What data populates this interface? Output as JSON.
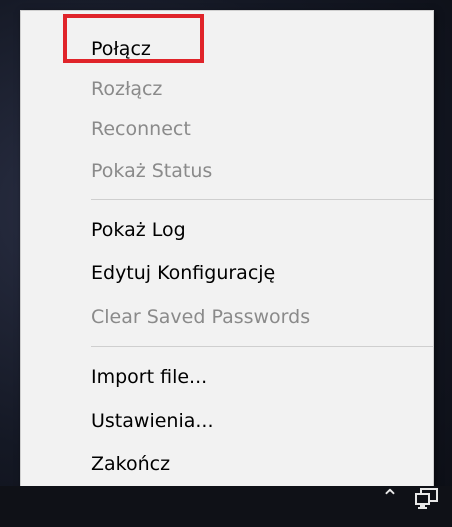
{
  "menu": {
    "items": [
      {
        "label": "Połącz",
        "enabled": true
      },
      {
        "label": "Rozłącz",
        "enabled": false
      },
      {
        "label": "Reconnect",
        "enabled": false
      },
      {
        "label": "Pokaż Status",
        "enabled": false
      },
      {
        "label": "Pokaż Log",
        "enabled": true
      },
      {
        "label": "Edytuj Konfigurację",
        "enabled": true
      },
      {
        "label": "Clear Saved Passwords",
        "enabled": false
      },
      {
        "label": "Import file...",
        "enabled": true
      },
      {
        "label": "Ustawienia...",
        "enabled": true
      },
      {
        "label": "Zakończ",
        "enabled": true
      }
    ]
  },
  "highlight": {
    "color": "#e0242a",
    "target": "Połącz"
  },
  "tray": {
    "icons": [
      "chevron-up-icon",
      "network-icon"
    ]
  },
  "colors": {
    "menu_bg": "#f2f2f2",
    "enabled_text": "#000000",
    "disabled_text": "#8a8a8a"
  }
}
